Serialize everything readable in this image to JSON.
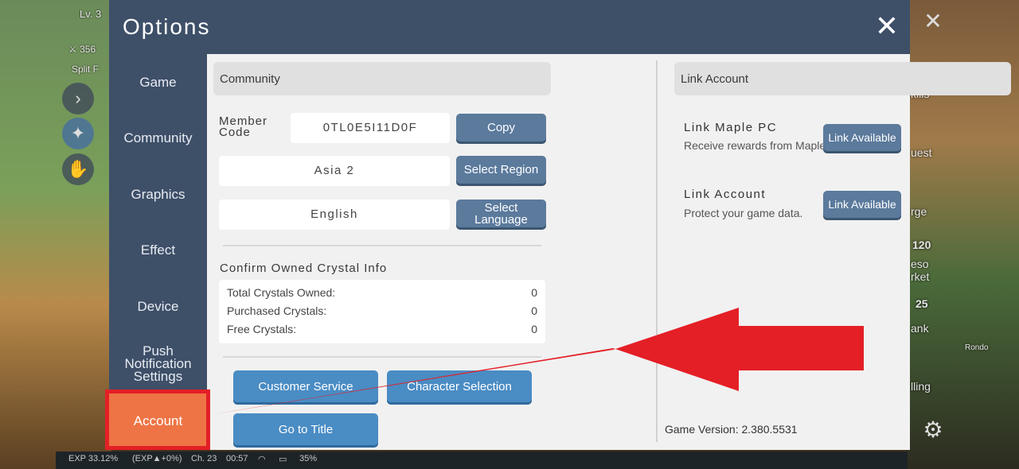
{
  "hud": {
    "level": "Lv. 3",
    "stat": "356",
    "split": "Split F",
    "right_labels": [
      "kills",
      "uest",
      "rge",
      "120",
      "eso",
      "rket",
      "25",
      "ank",
      "Rondo",
      "lling"
    ],
    "bottom": {
      "exp": "EXP 33.12%",
      "exp_gain": "(EXP▲+0%)",
      "channel": "Ch. 23",
      "time": "00:57",
      "battery": "35%"
    }
  },
  "dialog": {
    "title": "Options",
    "nav": [
      "Game",
      "Community",
      "Graphics",
      "Effect",
      "Device",
      "Push Notification Settings",
      "Account"
    ],
    "active_nav": "Account",
    "community": {
      "header": "Community",
      "member_code_label": "Member Code",
      "member_code_value": "0TL0E5I11D0F",
      "copy_label": "Copy",
      "region_value": "Asia 2",
      "select_region_label": "Select Region",
      "language_value": "English",
      "select_language_label": "Select Language",
      "crystal_header": "Confirm Owned Crystal Info",
      "crystals": [
        {
          "label": "Total Crystals Owned:",
          "value": "0"
        },
        {
          "label": "Purchased Crystals:",
          "value": "0"
        },
        {
          "label": "Free Crystals:",
          "value": "0"
        }
      ],
      "customer_service_label": "Customer Service",
      "character_selection_label": "Character Selection",
      "go_to_title_label": "Go to Title"
    },
    "link": {
      "header": "Link Account",
      "items": [
        {
          "title": "Link Maple PC",
          "desc": "Receive rewards from Maple PC.",
          "button": "Link Available"
        },
        {
          "title": "Link Account",
          "desc": "Protect your game data.",
          "button": "Link Available"
        }
      ],
      "version": "Game Version: 2.380.5531"
    }
  },
  "colors": {
    "header": "#3e4f68",
    "active_tab": "#ee7445",
    "button": "#5b7a9c",
    "action_button": "#4a8cc4",
    "annotation": "#e41f26"
  }
}
